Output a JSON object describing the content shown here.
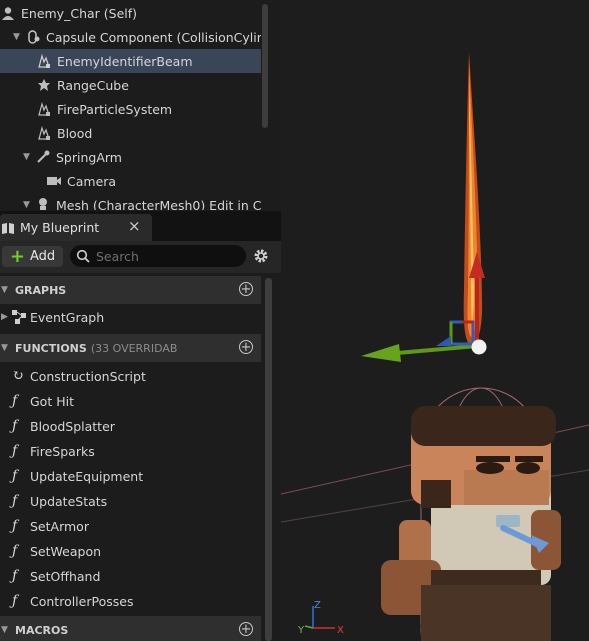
{
  "components": {
    "root": "Enemy_Char (Self)",
    "items": [
      {
        "label": "Capsule Component (CollisionCylinde",
        "icon": "capsule-component-icon"
      },
      {
        "label": "EnemyIdentifierBeam",
        "icon": "particle-system-icon"
      },
      {
        "label": "RangeCube",
        "icon": "static-mesh-icon"
      },
      {
        "label": "FireParticleSystem",
        "icon": "particle-system-icon"
      },
      {
        "label": "Blood",
        "icon": "particle-system-icon"
      },
      {
        "label": "SpringArm",
        "icon": "spring-arm-icon"
      },
      {
        "label": "Camera",
        "icon": "camera-icon"
      },
      {
        "label": "Mesh (CharacterMesh0)   Edit in C+",
        "icon": "skeletal-mesh-icon"
      }
    ]
  },
  "blueprint": {
    "tab_label": "My Blueprint",
    "close": "×",
    "add_label": "Add",
    "search_placeholder": "Search",
    "sections": {
      "graphs": {
        "title": "GRAPHS",
        "items": [
          "EventGraph"
        ]
      },
      "functions": {
        "title": "FUNCTIONS",
        "subtitle": "(33 OVERRIDAB",
        "items": [
          "ConstructionScript",
          "Got Hit",
          "BloodSplatter",
          "FireSparks",
          "UpdateEquipment",
          "UpdateStats",
          "SetArmor",
          "SetWeapon",
          "SetOffhand",
          "ControllerPosses"
        ]
      },
      "macros": {
        "title": "MACROS"
      }
    }
  },
  "viewport": {
    "axis_labels": {
      "x": "X",
      "y": "Y",
      "z": "Z"
    }
  }
}
